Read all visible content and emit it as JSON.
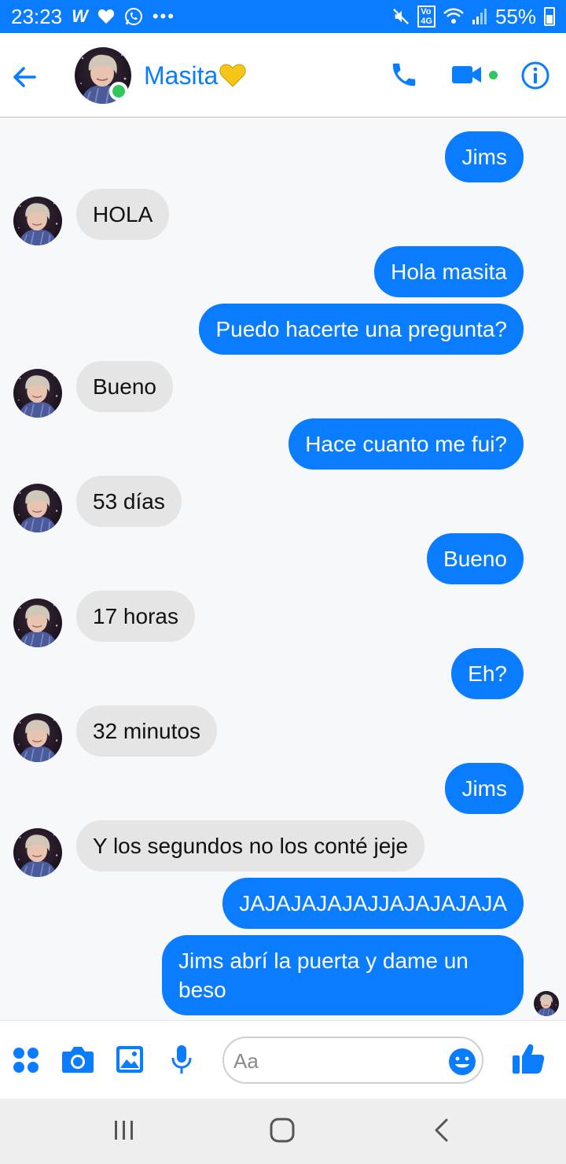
{
  "status_bar": {
    "time": "23:23",
    "notif_icons": [
      "w-icon",
      "heart-icon",
      "whatsapp-icon",
      "more-icon"
    ],
    "battery": "55%",
    "network_badge": "VoLTE 4G"
  },
  "header": {
    "contact_name": "Masita",
    "contact_emoji": "yellow-heart-icon",
    "online": true,
    "accent_color": "#0a7cff"
  },
  "messages": [
    {
      "side": "out",
      "text": "Jims"
    },
    {
      "side": "in",
      "text": "HOLA"
    },
    {
      "side": "out",
      "text": "Hola masita"
    },
    {
      "side": "out",
      "text": "Puedo hacerte una pregunta?"
    },
    {
      "side": "in",
      "text": "Bueno"
    },
    {
      "side": "out",
      "text": "Hace cuanto me fui?"
    },
    {
      "side": "in",
      "text": "53 días"
    },
    {
      "side": "out",
      "text": "Bueno"
    },
    {
      "side": "in",
      "text": "17 horas"
    },
    {
      "side": "out",
      "text": "Eh?"
    },
    {
      "side": "in",
      "text": "32 minutos"
    },
    {
      "side": "out",
      "text": "Jims"
    },
    {
      "side": "in",
      "text": "Y los segundos no los conté jeje"
    },
    {
      "side": "out",
      "text": "JAJAJAJAJAJJAJAJAJAJA"
    },
    {
      "side": "out",
      "text": "Jims abrí la puerta y dame un beso"
    }
  ],
  "composer": {
    "placeholder": "Aa"
  }
}
